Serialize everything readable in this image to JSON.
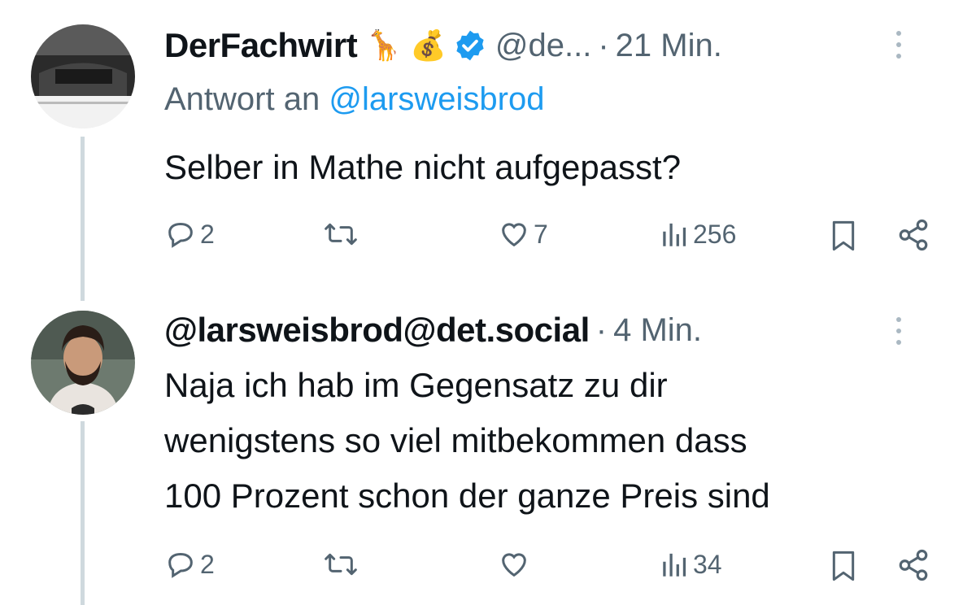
{
  "tweets": [
    {
      "display_name": "DerFachwirt",
      "emojis": [
        "🦒",
        "💰"
      ],
      "verified": true,
      "handle": "@de...",
      "time_sep": "·",
      "time": "21 Min.",
      "reply_prefix": "Antwort an",
      "reply_handle": "@larsweisbrod",
      "text": "Selber in Mathe nicht aufgepasst?",
      "actions": {
        "replies": "2",
        "reposts": "",
        "likes": "7",
        "views": "256"
      },
      "avatar_icon": "car-photo-avatar"
    },
    {
      "display_name": "@larsweisbrod@det.social",
      "time_sep": "·",
      "time": "4 Min.",
      "text_lines": [
        "Naja ich hab im Gegensatz zu dir",
        "wenigstens so viel mitbekommen dass",
        "100 Prozent schon der ganze Preis sind"
      ],
      "actions": {
        "replies": "2",
        "reposts": "",
        "likes": "",
        "views": "34"
      },
      "avatar_icon": "bearded-man-avatar"
    }
  ],
  "colors": {
    "text": "#0f1419",
    "secondary": "#536471",
    "link": "#1d9bf0",
    "verified": "#1d9bf0",
    "thread_line": "#cfd9de"
  },
  "icons": [
    "reply-icon",
    "repost-icon",
    "like-icon",
    "views-icon",
    "bookmark-icon",
    "share-icon",
    "more-icon",
    "verified-icon"
  ]
}
